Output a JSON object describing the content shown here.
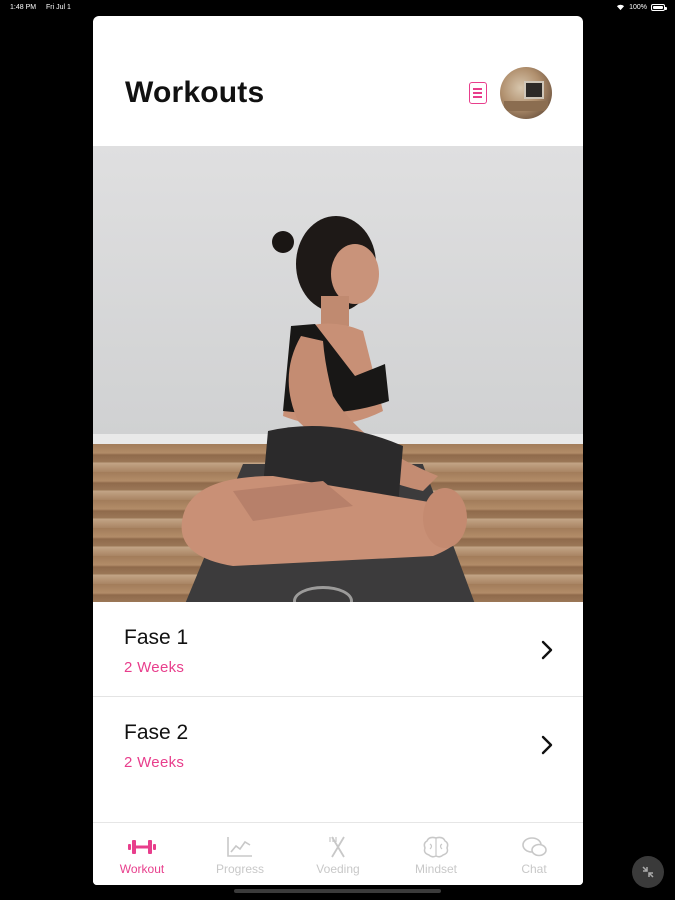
{
  "status_bar": {
    "time": "1:48 PM",
    "date": "Fri Jul 1",
    "battery": "100%"
  },
  "header": {
    "title": "Workouts"
  },
  "hero": {
    "icon": "yoga-photo"
  },
  "phases": [
    {
      "title": "Fase 1",
      "duration": "2 Weeks"
    },
    {
      "title": "Fase 2",
      "duration": "2 Weeks"
    }
  ],
  "tabs": [
    {
      "label": "Workout",
      "icon": "dumbbell-icon",
      "active": true
    },
    {
      "label": "Progress",
      "icon": "chart-icon",
      "active": false
    },
    {
      "label": "Voeding",
      "icon": "fork-knife-icon",
      "active": false
    },
    {
      "label": "Mindset",
      "icon": "brain-icon",
      "active": false
    },
    {
      "label": "Chat",
      "icon": "chat-bubbles-icon",
      "active": false
    }
  ],
  "colors": {
    "accent": "#e83e8c",
    "inactive": "#c8c8c8",
    "text": "#111111"
  }
}
